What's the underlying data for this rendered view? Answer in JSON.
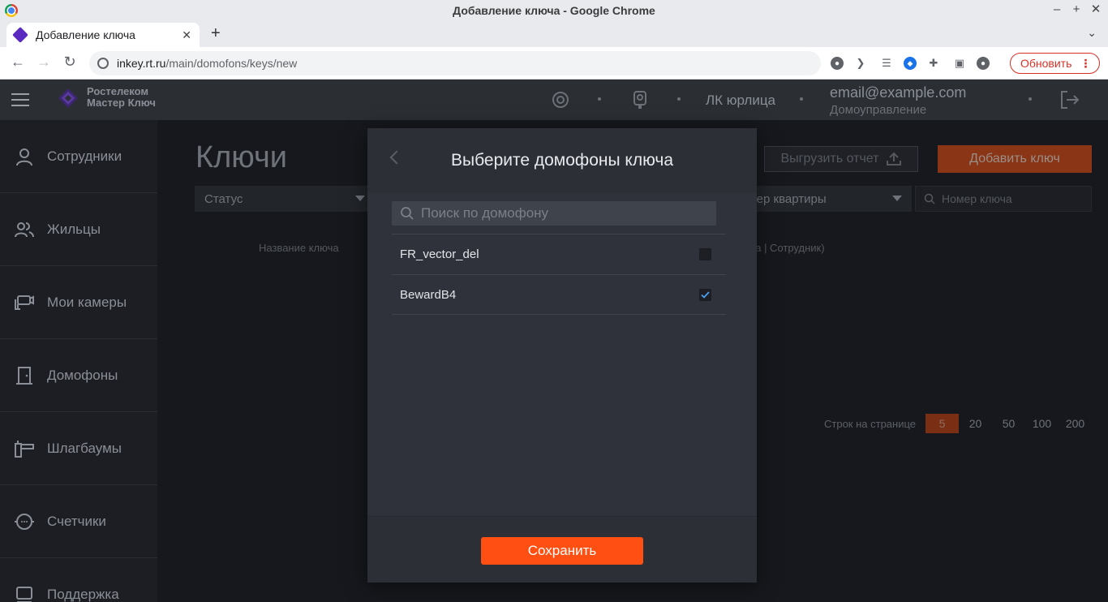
{
  "window": {
    "title": "Добавление ключа - Google Chrome"
  },
  "browser": {
    "tab_title": "Добавление ключа",
    "url_host": "inkey.rt.ru",
    "url_path": "/main/domofons/keys/new",
    "update_label": "Обновить"
  },
  "header": {
    "logo_line1": "Ростелеком",
    "logo_line2": "Мастер Ключ",
    "lk_label": "ЛК юрлица",
    "email": "email@example.com",
    "role": "Домоуправление"
  },
  "sidebar": {
    "items": [
      {
        "label": "Сотрудники",
        "icon": "person-icon"
      },
      {
        "label": "Жильцы",
        "icon": "people-icon"
      },
      {
        "label": "Мои камеры",
        "icon": "camera-icon"
      },
      {
        "label": "Домофоны",
        "icon": "door-icon"
      },
      {
        "label": "Шлагбаумы",
        "icon": "barrier-icon"
      },
      {
        "label": "Счетчики",
        "icon": "meter-icon"
      },
      {
        "label": "Поддержка",
        "icon": "support-icon"
      }
    ]
  },
  "page": {
    "title": "Ключи",
    "export_label": "Выгрузить отчет",
    "add_label": "Добавить ключ",
    "filter_status": "Статус",
    "filter_apartment": "омер квартиры",
    "filter_key_placeholder": "Номер ключа",
    "col_name": "Название ключа",
    "col_owner": "ра | Сотрудник)",
    "rows_per_page_label": "Строк на странице",
    "page_sizes": [
      "5",
      "20",
      "50",
      "100",
      "200"
    ],
    "active_page_size": "5"
  },
  "modal": {
    "title": "Выберите домофоны ключа",
    "search_placeholder": "Поиск по домофону",
    "items": [
      {
        "label": "FR_vector_del",
        "checked": false
      },
      {
        "label": "BewardB4",
        "checked": true
      }
    ],
    "save_label": "Сохранить"
  },
  "colors": {
    "accent": "#ff4f12",
    "modal_bg": "#2c2f36",
    "page_bg": "#16181d"
  }
}
